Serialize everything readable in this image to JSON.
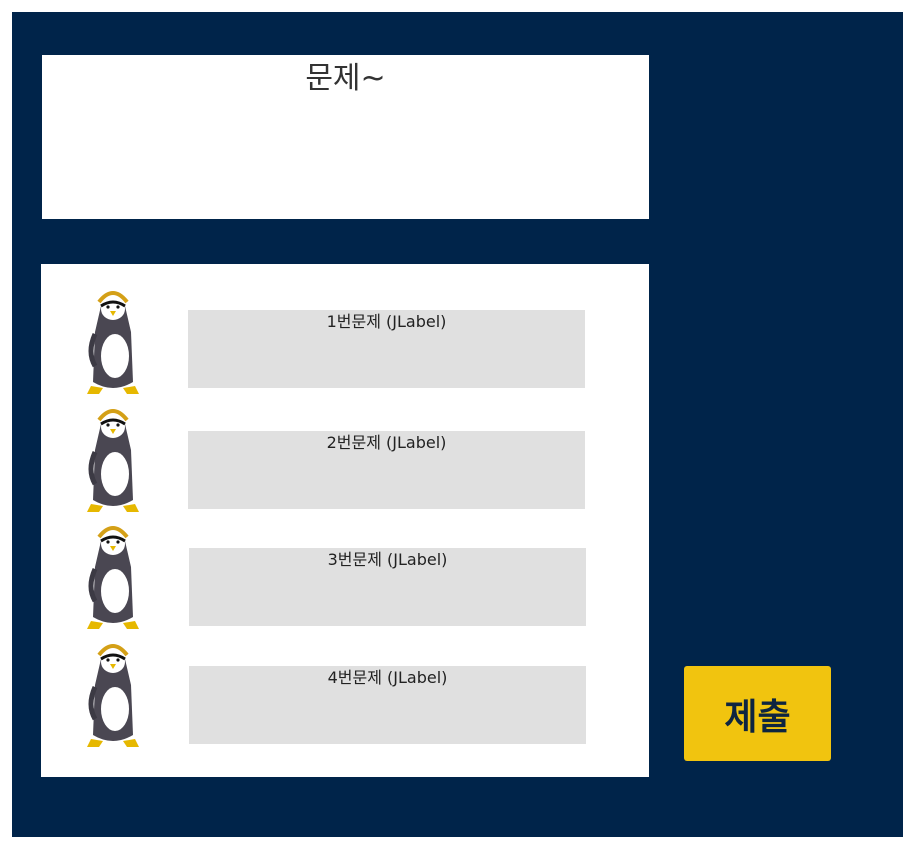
{
  "question": {
    "title": "문제~"
  },
  "answers": [
    {
      "label": "1번문제 (JLabel)"
    },
    {
      "label": "2번문제 (JLabel)"
    },
    {
      "label": "3번문제 (JLabel)"
    },
    {
      "label": "4번문제 (JLabel)"
    }
  ],
  "submit": {
    "label": "제출"
  },
  "colors": {
    "frame_background": "#00244a",
    "panel_background": "#ffffff",
    "answer_background": "#e0e0e0",
    "submit_background": "#f1c40f",
    "submit_text": "#0e2540"
  },
  "icons": {
    "answer_marker": "penguin-icon"
  }
}
